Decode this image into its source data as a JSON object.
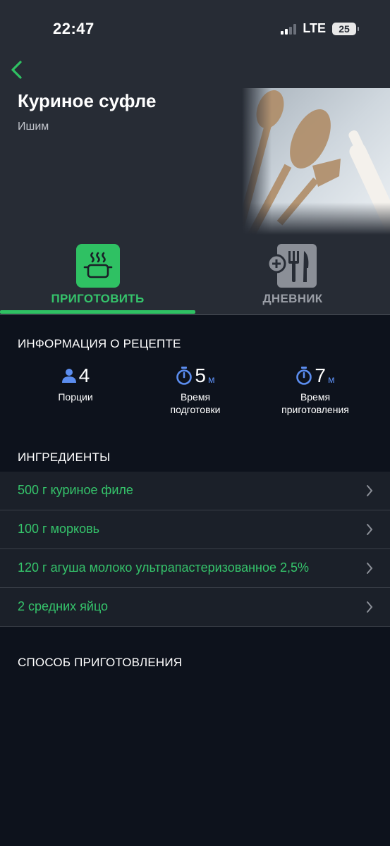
{
  "status_bar": {
    "time": "22:47",
    "network": "LTE",
    "battery": "25"
  },
  "recipe": {
    "title": "Куриное суфле",
    "subtitle": "Ишим"
  },
  "tabs": [
    {
      "label": "ПРИГОТОВИТЬ",
      "active": true
    },
    {
      "label": "ДНЕВНИК",
      "active": false
    }
  ],
  "info": {
    "section_title": "ИНФОРМАЦИЯ О РЕЦЕПТЕ",
    "servings": {
      "value": "4",
      "label": "Порции"
    },
    "prep_time": {
      "value": "5",
      "unit": "м",
      "label_line1": "Время",
      "label_line2": "подготовки"
    },
    "cook_time": {
      "value": "7",
      "unit": "м",
      "label_line1": "Время",
      "label_line2": "приготовления"
    }
  },
  "ingredients": {
    "section_title": "ИНГРЕДИЕНТЫ",
    "items": [
      {
        "text": "500 г куриное филе"
      },
      {
        "text": "100 г морковь"
      },
      {
        "text": "120 г агуша молоко ультрапастеризованное 2,5%"
      },
      {
        "text": "2 средних  яйцо"
      }
    ]
  },
  "method": {
    "section_title": "СПОСОБ ПРИГОТОВЛЕНИЯ"
  },
  "colors": {
    "accent": "#2fc163",
    "background": "#0d121c",
    "header": "#272c35",
    "info_icon": "#5b8def"
  }
}
